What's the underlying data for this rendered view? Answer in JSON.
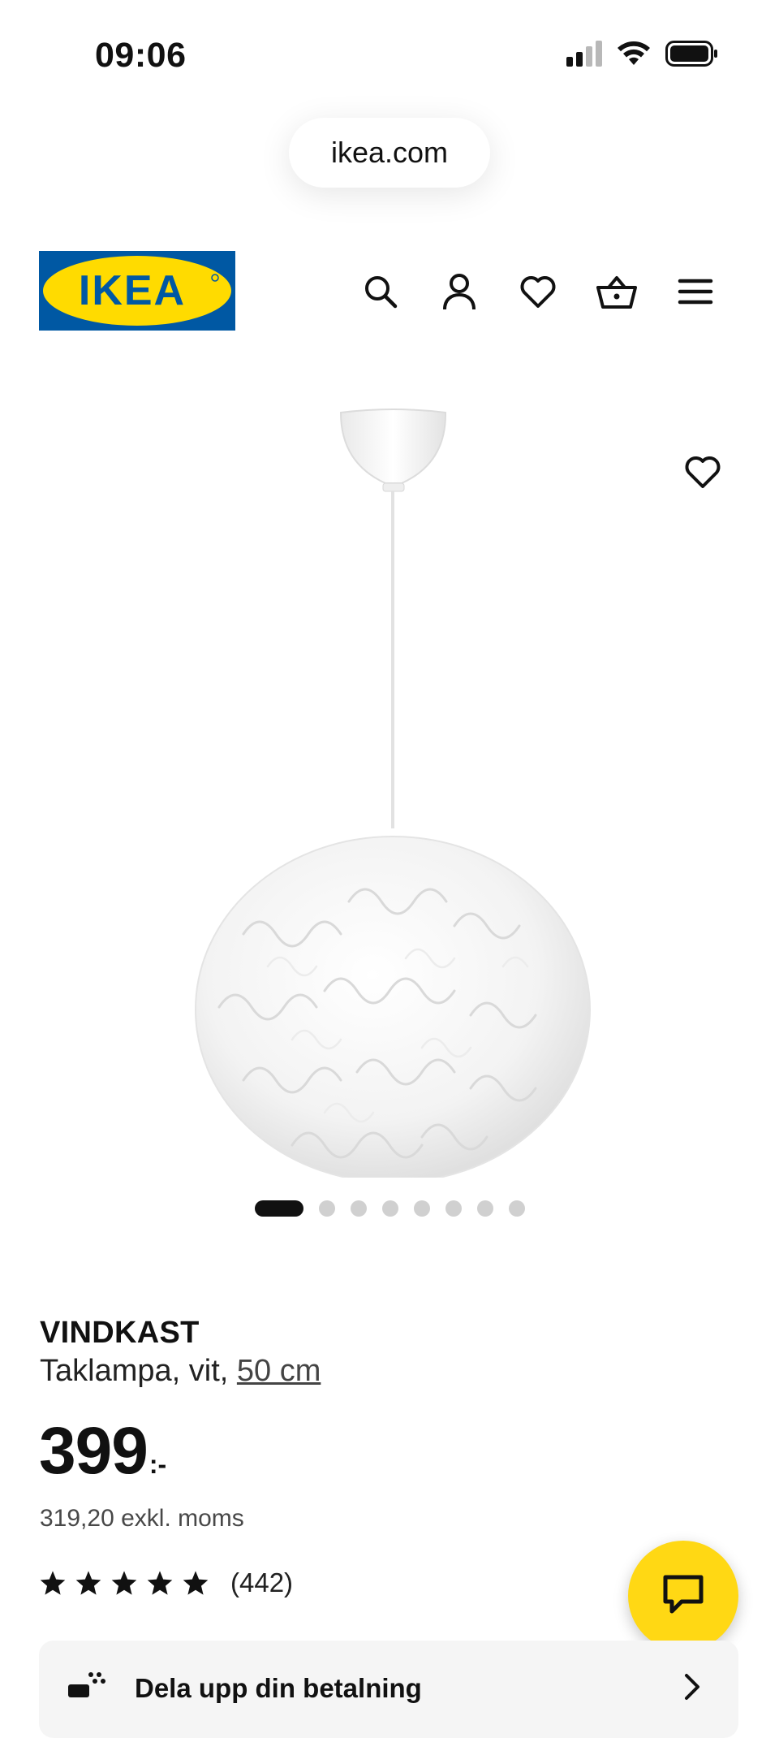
{
  "status_bar": {
    "time": "09:06"
  },
  "browser": {
    "url": "ikea.com"
  },
  "header": {
    "logo_text": "IKEA",
    "icons": [
      "search-icon",
      "profile-icon",
      "heart-icon",
      "shopping-basket-icon",
      "menu-icon"
    ]
  },
  "gallery": {
    "image_count": 8,
    "active_index": 0
  },
  "product": {
    "name": "VINDKAST",
    "description_prefix": "Taklampa, vit, ",
    "size_link": "50 cm",
    "price_integer": "399",
    "price_suffix": ":-",
    "price_excl_vat": "319,20 exkl. moms",
    "rating_stars": 5,
    "review_count": "(442)"
  },
  "payment_banner": {
    "label": "Dela upp din betalning"
  },
  "colors": {
    "ikea_blue": "#0058a3",
    "ikea_yellow": "#ffdb00",
    "chat_yellow": "#ffd814",
    "text": "#111111"
  }
}
